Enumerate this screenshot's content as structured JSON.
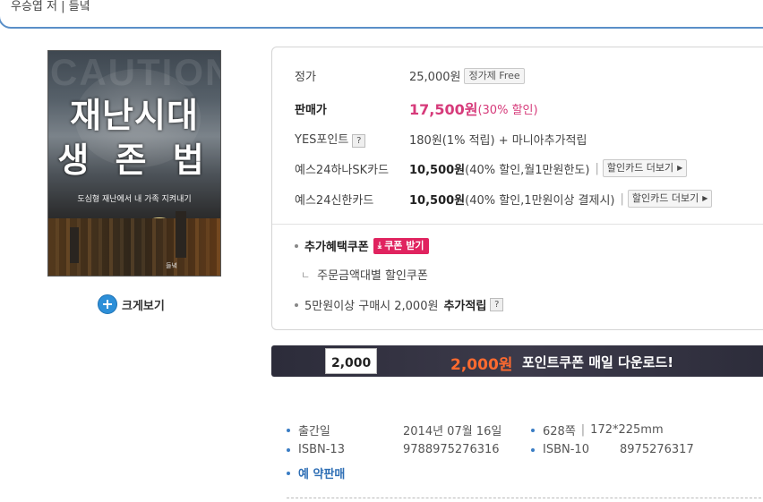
{
  "header": {
    "author_line": "우승엽 저 | 들녘"
  },
  "book": {
    "cover_title_1": "재난시대",
    "cover_title_2": "생 존 법",
    "cover_subtitle": "도심형 재난에서 내 가족 지켜내기",
    "cover_caution": "CAUTION",
    "cover_publisher": "들녘",
    "zoom_label": "크게보기"
  },
  "pricing": {
    "list_price_label": "정가",
    "list_price_value": "25,000원",
    "list_price_chip": "정가제 Free",
    "sale_price_label": "판매가",
    "sale_price_value": "17,500원",
    "sale_price_discount": "(30% 할인)",
    "yes_point_label": "YES포인트",
    "yes_point_help": "?",
    "yes_point_value": "180원(1% 적립) + 마니아추가적립",
    "card1_label": "예스24하나SK카드",
    "card1_price": "10,500원",
    "card1_desc": "(40% 할인,월1만원한도)",
    "card1_button": "할인카드 더보기",
    "card2_label": "예스24신한카드",
    "card2_price": "10,500원",
    "card2_desc": "(40% 할인,1만원이상 결제시)",
    "card2_button": "할인카드 더보기",
    "separator": "|",
    "arrow": "▶"
  },
  "benefits": {
    "coupon_label": "추가혜택쿠폰",
    "coupon_button": "쿠폰 받기",
    "coupon_sub_prefix": "ㄴ",
    "coupon_sub": "주문금액대별 할인쿠폰",
    "extra_point_prefix": "5만원이상 구매시 2,000원",
    "extra_point_bold": "추가적립",
    "extra_point_help": "?"
  },
  "banner": {
    "card_amount": "2,000",
    "amount": "2,000원",
    "text": "포인트쿠폰 매일 다운로드!"
  },
  "details": {
    "pub_date_label": "출간일",
    "pub_date_value": "2014년 07월 16일",
    "pages": "628쪽",
    "dimensions": "172*225mm",
    "isbn13_label": "ISBN-13",
    "isbn13_value": "9788975276316",
    "isbn10_label": "ISBN-10",
    "isbn10_value": "8975276317",
    "preorder": "예 약판매",
    "vsep": "|"
  },
  "colors": {
    "accent_pink": "#d63a7a",
    "coupon_pink": "#e0235f",
    "banner_orange": "#ff6a2f",
    "link_blue": "#2f6fb5",
    "header_border": "#5a8fc8"
  }
}
